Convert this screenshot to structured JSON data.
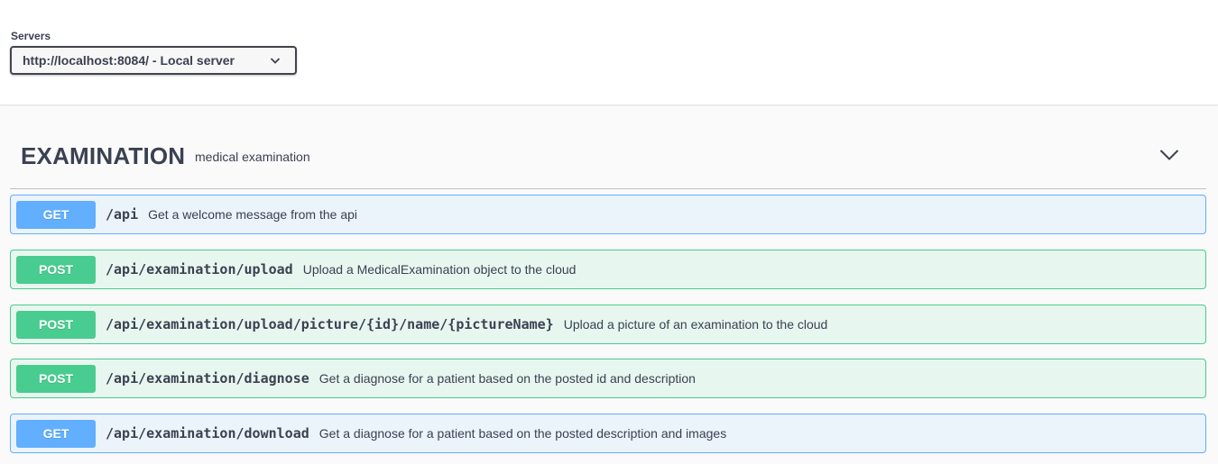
{
  "servers": {
    "label": "Servers",
    "selected": "http://localhost:8084/ - Local server"
  },
  "tag": {
    "name": "EXAMINATION",
    "description": "medical examination"
  },
  "operations": [
    {
      "method": "GET",
      "path": "/api",
      "summary": "Get a welcome message from the api"
    },
    {
      "method": "POST",
      "path": "/api/examination/upload",
      "summary": "Upload a MedicalExamination object to the cloud"
    },
    {
      "method": "POST",
      "path": "/api/examination/upload/picture/{id}/name/{pictureName}",
      "summary": "Upload a picture of an examination to the cloud"
    },
    {
      "method": "POST",
      "path": "/api/examination/diagnose",
      "summary": "Get a diagnose for a patient based on the posted id and description"
    },
    {
      "method": "GET",
      "path": "/api/examination/download",
      "summary": "Get a diagnose for a patient based on the posted description and images"
    }
  ],
  "colors": {
    "get": "#61affe",
    "post": "#49cc90",
    "text": "#3b4151"
  }
}
